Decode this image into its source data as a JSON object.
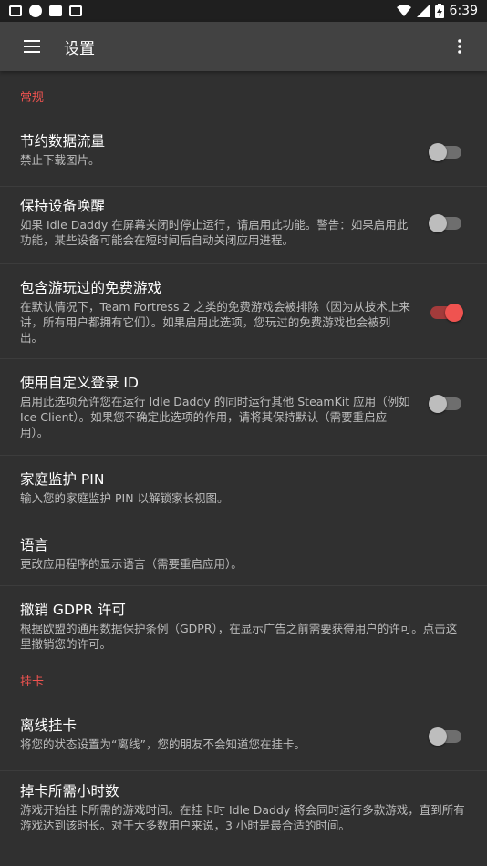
{
  "status_bar": {
    "time": "6:39",
    "icons": [
      "voicemail-icon",
      "cx-icon",
      "message-icon",
      "a-icon",
      "wifi-icon",
      "signal-icon",
      "battery-icon"
    ]
  },
  "app_bar": {
    "title": "设置",
    "menu_icon": "hamburger-icon",
    "more_icon": "more-vert-icon"
  },
  "colors": {
    "accent": "#ef5350",
    "background": "#303030",
    "toolbar": "#424242"
  },
  "sections": [
    {
      "header": "常规",
      "items": [
        {
          "title": "节约数据流量",
          "summary": "禁止下载图片。",
          "switch": true,
          "checked": false
        },
        {
          "title": "保持设备唤醒",
          "summary": "如果 Idle Daddy 在屏幕关闭时停止运行，请启用此功能。警告：如果启用此功能，某些设备可能会在短时间后自动关闭应用进程。",
          "switch": true,
          "checked": false
        },
        {
          "title": "包含游玩过的免费游戏",
          "summary": "在默认情况下，Team Fortress 2 之类的免费游戏会被排除（因为从技术上来讲，所有用户都拥有它们）。如果启用此选项，您玩过的免费游戏也会被列出。",
          "switch": true,
          "checked": true
        },
        {
          "title": "使用自定义登录 ID",
          "summary": "启用此选项允许您在运行 Idle Daddy 的同时运行其他 SteamKit 应用（例如 Ice Client）。如果您不确定此选项的作用，请将其保持默认（需要重启应用）。",
          "switch": true,
          "checked": false
        },
        {
          "title": "家庭监护 PIN",
          "summary": "输入您的家庭监护 PIN 以解锁家长视图。",
          "switch": false
        },
        {
          "title": "语言",
          "summary": "更改应用程序的显示语言（需要重启应用）。",
          "switch": false
        },
        {
          "title": "撤销 GDPR 许可",
          "summary": "根据欧盟的通用数据保护条例（GDPR），在显示广告之前需要获得用户的许可。点击这里撤销您的许可。",
          "switch": false
        }
      ]
    },
    {
      "header": "挂卡",
      "items": [
        {
          "title": "离线挂卡",
          "summary": "将您的状态设置为“离线”，您的朋友不会知道您在挂卡。",
          "switch": true,
          "checked": false
        },
        {
          "title": "掉卡所需小时数",
          "summary": "游戏开始挂卡所需的游戏时间。在挂卡时 Idle Daddy 将会同时运行多款游戏，直到所有游戏达到该时长。对于大多数用户来说，3 小时是最合适的时间。",
          "switch": false
        }
      ]
    }
  ]
}
